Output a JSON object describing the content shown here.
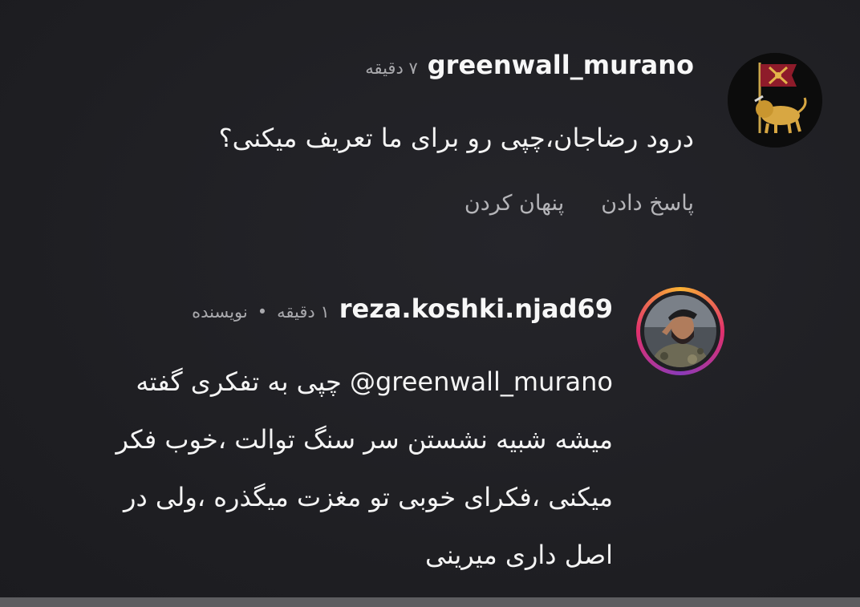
{
  "comments": [
    {
      "username": "greenwall_murano",
      "time": "۷ دقیقه",
      "text": "درود رضاجان،چپی رو برای ما تعریف میکنی؟",
      "actions": {
        "reply": "پاسخ دادن",
        "hide": "پنهان کردن"
      },
      "avatar": "lion-and-sun-flag-icon"
    },
    {
      "username": "reza.koshki.njad69",
      "time": "۱ دقیقه",
      "separator": "•",
      "author_badge": "نویسنده",
      "mention": "@greenwall_murano",
      "text_line1": "چپی به تفکری گفته",
      "text_line2": "میشه شبیه نشستن سر سنگ توالت ،خوب فکر",
      "text_line3": "میکنی ،فکرای خوبی تو مغزت میگذره ،ولی در",
      "text_line4": "اصل داری میرینی",
      "avatar": "soldier-portrait",
      "story_ring_colors": [
        "#f9b233",
        "#e1306c",
        "#8a3ab9"
      ]
    }
  ]
}
